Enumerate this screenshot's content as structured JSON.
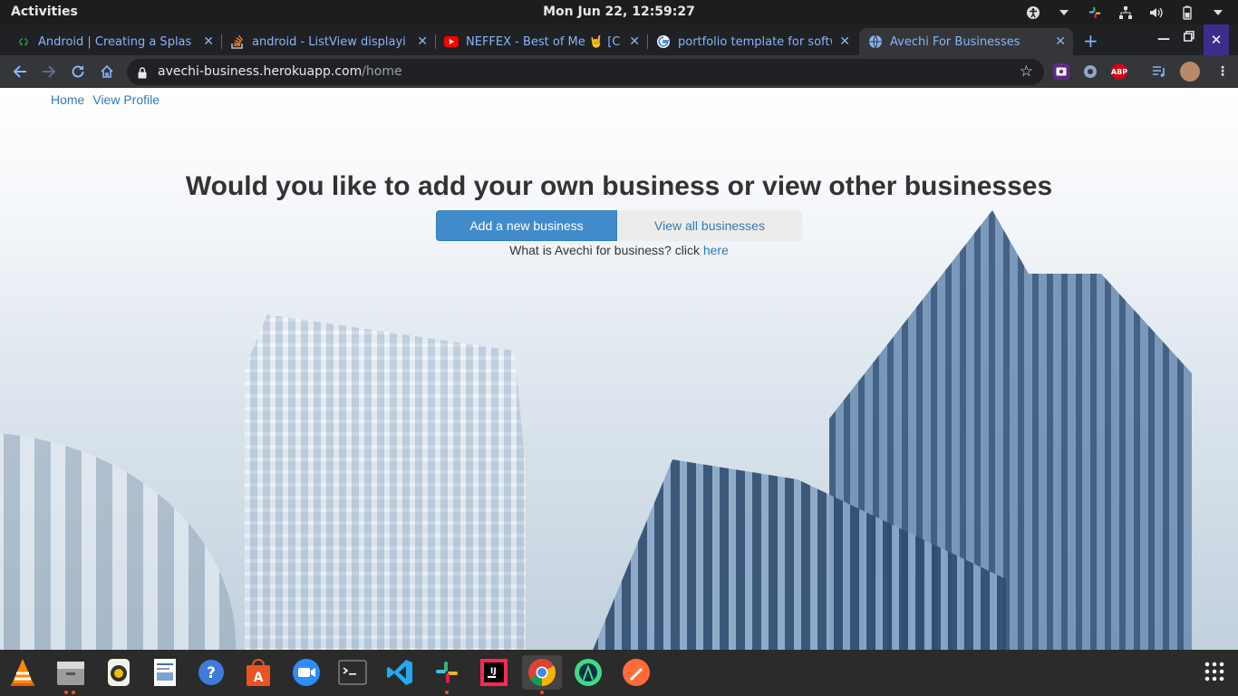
{
  "system": {
    "activities_label": "Activities",
    "clock": "Mon Jun 22, 12:59:27"
  },
  "tabs": [
    {
      "title": "Android | Creating a Splash S",
      "favicon": "gfg-icon",
      "color": "#2f8d46"
    },
    {
      "title": "android - ListView displaying",
      "favicon": "stackoverflow-icon",
      "color": "#f48024"
    },
    {
      "title": "NEFFEX - Best of Me 🤘 [Cop",
      "favicon": "youtube-icon",
      "color": "#ff0000"
    },
    {
      "title": "portfolio template for softw",
      "favicon": "google-icon",
      "color": "#4285f4"
    },
    {
      "title": "Avechi For Businesses",
      "favicon": "globe-icon",
      "color": "#8ab4f8"
    }
  ],
  "address_bar": {
    "host": "avechi-business.herokuapp.com",
    "path": "/home"
  },
  "page": {
    "nav": {
      "home": "Home",
      "view_profile": "View Profile"
    },
    "heading": "Would you like to add your own business or view other businesses",
    "add_button": "Add a new business",
    "view_button": "View all businesses",
    "question_text": "What is Avechi for business? click ",
    "question_link": "here"
  },
  "extensions": {
    "abp_label": "ABP"
  },
  "dock": [
    {
      "name": "vlc-icon"
    },
    {
      "name": "files-icon"
    },
    {
      "name": "rhythmbox-icon"
    },
    {
      "name": "document-viewer-icon"
    },
    {
      "name": "help-icon"
    },
    {
      "name": "software-center-icon"
    },
    {
      "name": "zoom-icon"
    },
    {
      "name": "terminal-icon"
    },
    {
      "name": "vscode-icon"
    },
    {
      "name": "slack-icon"
    },
    {
      "name": "intellij-icon"
    },
    {
      "name": "chrome-icon"
    },
    {
      "name": "android-studio-icon"
    },
    {
      "name": "postman-icon"
    }
  ],
  "colors": {
    "primary": "#428bca",
    "link": "#337ab7"
  }
}
